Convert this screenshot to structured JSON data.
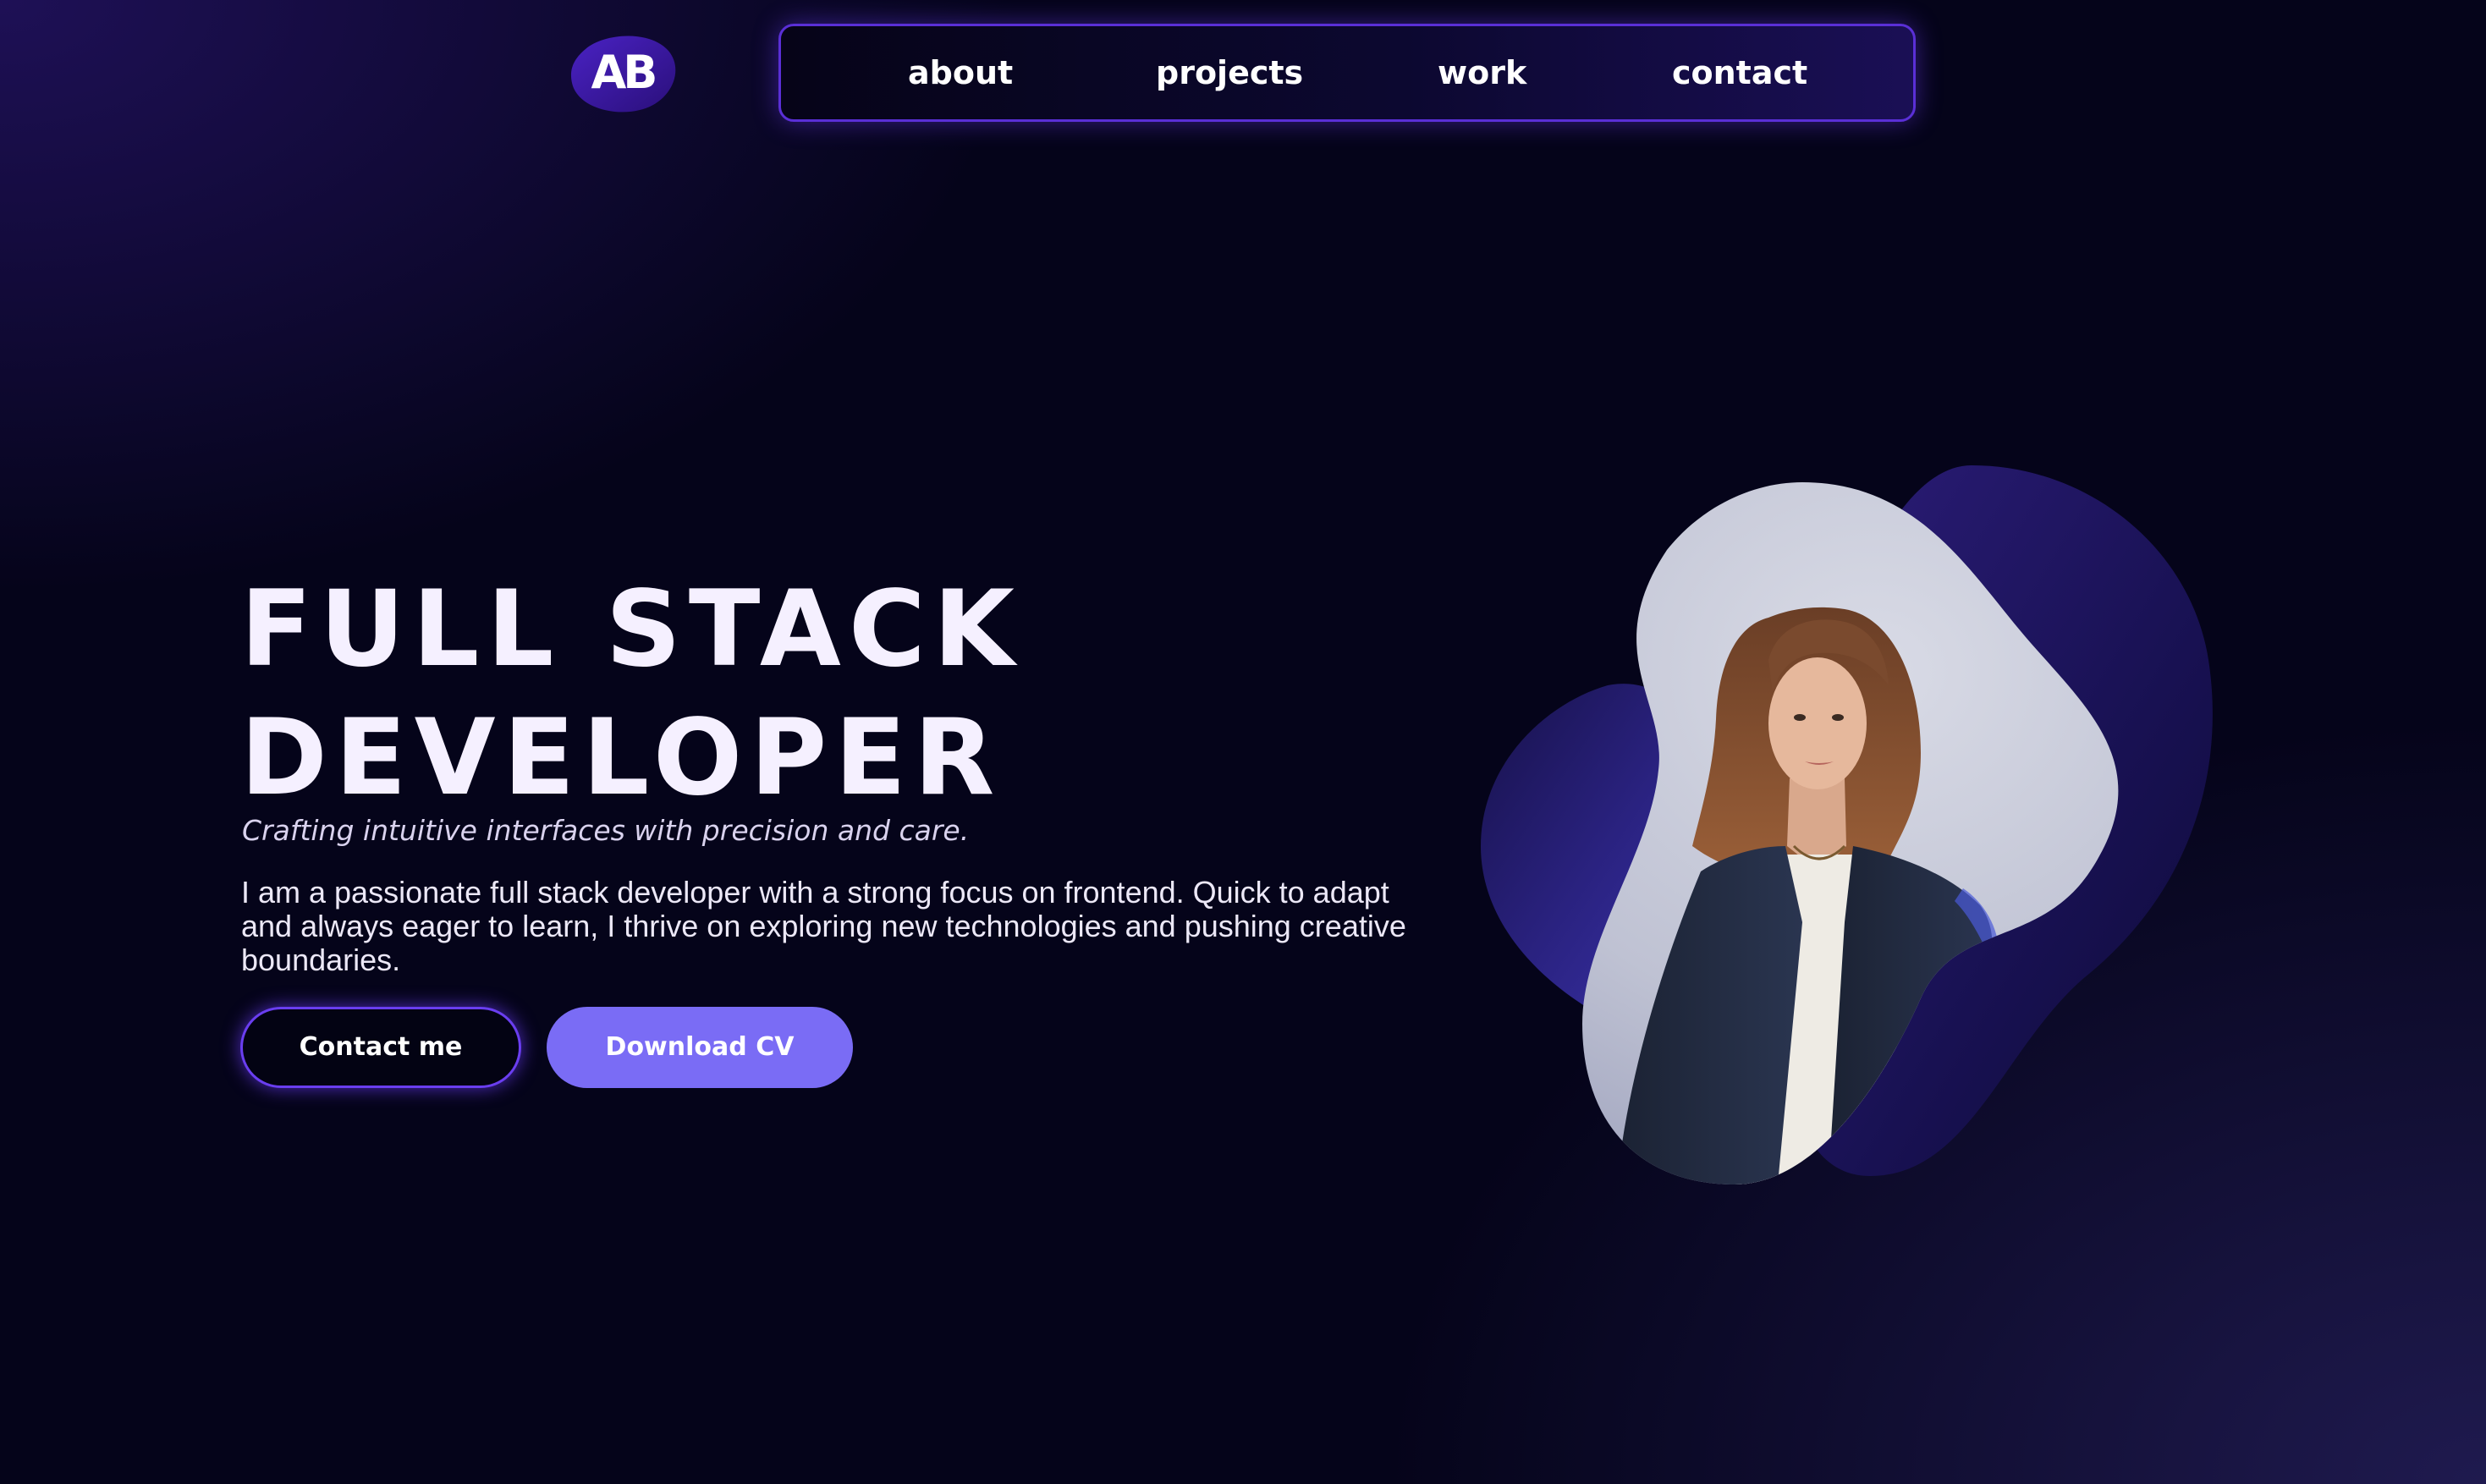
{
  "logo": {
    "text": "AB",
    "icon": "ab-monogram-logo",
    "background_color": "#3a1a9a"
  },
  "nav": {
    "items": [
      {
        "label": "about"
      },
      {
        "label": "projects"
      },
      {
        "label": "work"
      },
      {
        "label": "contact"
      }
    ],
    "border_color": "#5a2fd6"
  },
  "hero": {
    "title_line1": "FULL STACK",
    "title_line2": "DEVELOPER",
    "tagline": "Crafting intuitive interfaces with precision and care.",
    "bio": "I am a passionate full stack developer with a strong focus on frontend. Quick to adapt and always eager to learn, I thrive on exploring new technologies and pushing creative boundaries."
  },
  "buttons": {
    "contact_label": "Contact me",
    "download_label": "Download CV"
  },
  "portrait": {
    "alt": "Portrait of a woman with shoulder-length auburn hair wearing a navy blazer and white blouse",
    "icon": "profile-photo"
  },
  "colors": {
    "background": "#05041a",
    "accent": "#7a6cf5",
    "accent_dark": "#5a2fd6",
    "text": "#f5f0ff"
  }
}
